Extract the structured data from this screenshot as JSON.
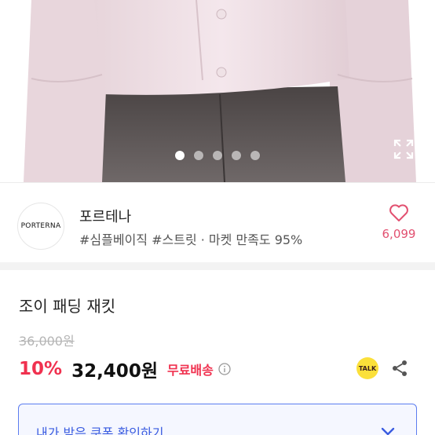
{
  "hero": {
    "carousel_count": 5,
    "carousel_active_index": 0
  },
  "seller": {
    "logo_text": "PORTERNA",
    "name": "포르테나",
    "tags": "#심플베이직 #스트릿 · 마켓 만족도 95%",
    "like_count": "6,099"
  },
  "product": {
    "title": "조이 패딩 재킷",
    "original_price": "36,000원",
    "discount": "10%",
    "price": "32,400원",
    "shipping": "무료배송"
  },
  "actions": {
    "talk_label": "TALK"
  },
  "coupon": {
    "label": "내가 받은 쿠폰 확인하기"
  },
  "colors": {
    "accent_red": "#f0314f",
    "like_pink": "#e25070",
    "coupon_blue": "#3a5ce0",
    "kakao_yellow": "#fbe03a"
  }
}
